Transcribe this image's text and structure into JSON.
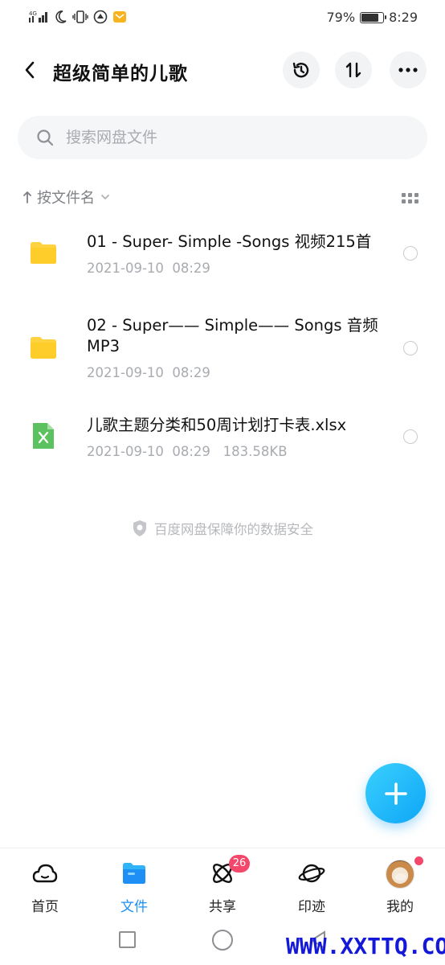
{
  "status_bar": {
    "battery_percent": "79%",
    "battery_level": 0.79,
    "time": "8:29",
    "network": "4G"
  },
  "header": {
    "title": "超级简单的儿歌"
  },
  "search": {
    "placeholder": "搜索网盘文件"
  },
  "sort": {
    "label": "按文件名"
  },
  "files": [
    {
      "name": "01 - Super- Simple -Songs 视频215首",
      "meta": "2021-09-10  08:29",
      "type": "folder"
    },
    {
      "name": "02 - Super—— Simple—— Songs 音频MP3",
      "meta": "2021-09-10  08:29",
      "type": "folder"
    },
    {
      "name": "儿歌主题分类和50周计划打卡表.xlsx",
      "meta": "2021-09-10  08:29   183.58KB",
      "type": "excel"
    }
  ],
  "safety_note": "百度网盘保障你的数据安全",
  "nav": {
    "items": [
      {
        "label": "首页"
      },
      {
        "label": "文件"
      },
      {
        "label": "共享",
        "badge": "26"
      },
      {
        "label": "印迹"
      },
      {
        "label": "我的"
      }
    ]
  },
  "colors": {
    "accent": "#1d8ff5",
    "folder": "#ffd23f",
    "excel": "#5cc15f",
    "badge": "#f3486b"
  },
  "watermark": "WWW.XXTTQ.COM"
}
